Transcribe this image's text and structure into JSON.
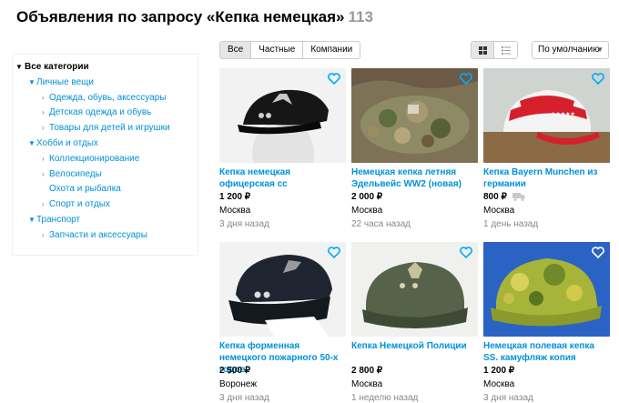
{
  "header": {
    "title": "Объявления по запросу «Кепка немецкая»",
    "count": "113"
  },
  "sidebar": {
    "root": "Все категории",
    "groups": [
      {
        "label": "Личные вещи",
        "items": [
          "Одежда, обувь, аксессуары",
          "Детская одежда и обувь",
          "Товары для детей и игрушки"
        ]
      },
      {
        "label": "Хобби и отдых",
        "items": [
          "Коллекционирование",
          "Велосипеды",
          "Охота и рыбалка",
          "Спорт и отдых"
        ]
      },
      {
        "label": "Транспорт",
        "items": [
          "Запчасти и аксессуары"
        ]
      }
    ]
  },
  "filters": {
    "all": "Все",
    "private": "Частные",
    "companies": "Компании",
    "active": "all"
  },
  "view": {
    "grid_icon": "grid-icon",
    "list_icon": "list-icon",
    "active": "grid"
  },
  "sort": {
    "value": "По умолчанию"
  },
  "colors": {
    "link": "#0091d9",
    "heart": "#00aaff",
    "muted": "#999999"
  },
  "listings": [
    {
      "title": "Кепка немецкая офицерская сс",
      "price": "1 200 ₽",
      "city": "Москва",
      "date": "3 дня назад",
      "delivery": false
    },
    {
      "title": "Немецкая кепка летняя Эдельвейс WW2 (новая)",
      "price": "2 000 ₽",
      "city": "Москва",
      "date": "22 часа назад",
      "delivery": false
    },
    {
      "title": "Кепка Bayern Munchen из германии",
      "price": "800 ₽",
      "city": "Москва",
      "date": "1 день назад",
      "delivery": true
    },
    {
      "title": "Кепка форменная немецкого пожарного 50-х годов",
      "price": "2 500 ₽",
      "city": "Воронеж",
      "date": "3 дня назад",
      "delivery": false
    },
    {
      "title": "Кепка Немецкой Полиции",
      "price": "2 800 ₽",
      "city": "Москва",
      "date": "1 неделю назад",
      "delivery": false
    },
    {
      "title": "Немецкая полевая кепка SS. камуфляж копия",
      "price": "1 200 ₽",
      "city": "Москва",
      "date": "3 дня назад",
      "delivery": false
    }
  ]
}
